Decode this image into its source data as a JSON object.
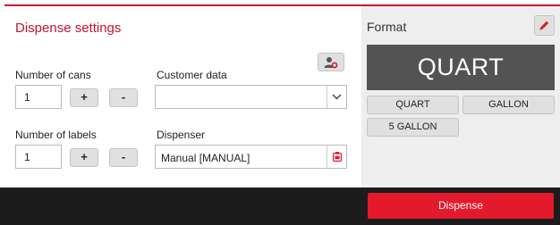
{
  "dispense_settings": {
    "title": "Dispense settings",
    "number_of_cans_label": "Number of cans",
    "number_of_cans_value": "1",
    "number_of_labels_label": "Number of labels",
    "number_of_labels_value": "1",
    "plus_label": "+",
    "minus_label": "-",
    "customer_data_label": "Customer data",
    "customer_data_value": "",
    "dispenser_label": "Dispenser",
    "dispenser_value": "Manual [MANUAL]"
  },
  "format": {
    "title": "Format",
    "current": "QUART",
    "options": [
      "QUART",
      "GALLON",
      "5 GALLON"
    ]
  },
  "footer": {
    "dispense_label": "Dispense"
  },
  "colors": {
    "accent": "#c8102e",
    "dispense_button": "#e41a2c",
    "format_display": "#535353",
    "bottom_bar": "#1c1c1c"
  },
  "icons": [
    "add-customer-icon",
    "chevron-down-icon",
    "dispenser-icon",
    "pencil-icon"
  ]
}
